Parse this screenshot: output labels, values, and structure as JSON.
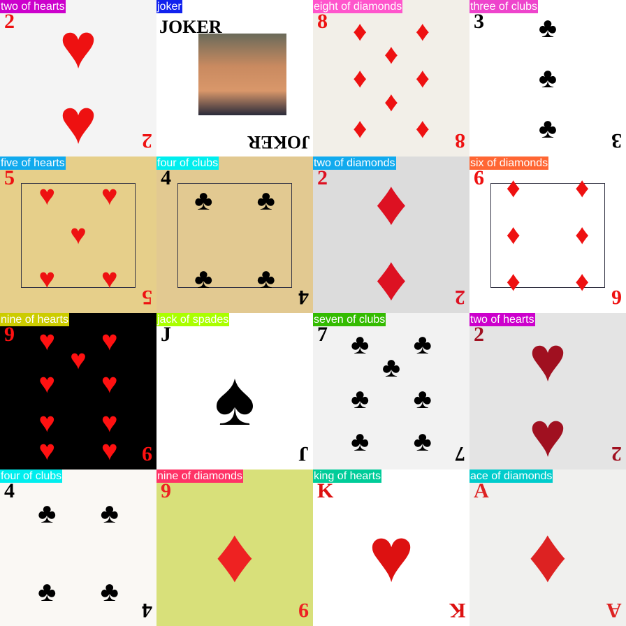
{
  "tiles": [
    {
      "label": "two of hearts",
      "label_color": "#cc00cc",
      "bg": "#f4f4f4",
      "rank": "2",
      "suit": "♥",
      "suit_color": "#ee1111",
      "pips": 2
    },
    {
      "label": "joker",
      "label_color": "#1122ee",
      "bg": "#ffffff",
      "rank": "",
      "suit": "",
      "suit_color": "#111111",
      "pips": 0,
      "joker_text": "JOKER"
    },
    {
      "label": "eight of diamonds",
      "label_color": "#ff55cc",
      "bg": "#f2efe8",
      "rank": "8",
      "suit": "♦",
      "suit_color": "#ee1111",
      "pips": 8
    },
    {
      "label": "three of clubs",
      "label_color": "#ee44cc",
      "bg": "#ffffff",
      "rank": "3",
      "suit": "♣",
      "suit_color": "#000000",
      "pips": 3
    },
    {
      "label": "five of hearts",
      "label_color": "#11aaee",
      "bg": "#e6cf8a",
      "rank": "5",
      "suit": "♥",
      "suit_color": "#ee1111",
      "pips": 5,
      "framed": true
    },
    {
      "label": "four of clubs",
      "label_color": "#00eeee",
      "bg": "#e2c991",
      "rank": "4",
      "suit": "♣",
      "suit_color": "#000000",
      "pips": 4,
      "framed": true
    },
    {
      "label": "two of diamonds",
      "label_color": "#11aaee",
      "bg": "#dcdcdc",
      "rank": "2",
      "suit": "♦",
      "suit_color": "#dd1122",
      "pips": 2
    },
    {
      "label": "six of diamonds",
      "label_color": "#ff6633",
      "bg": "#ffffff",
      "rank": "6",
      "suit": "♦",
      "suit_color": "#ee1111",
      "pips": 6,
      "framed": true
    },
    {
      "label": "nine of hearts",
      "label_color": "#cccc00",
      "bg": "#000000",
      "rank": "9",
      "suit": "♥",
      "suit_color": "#ff1111",
      "pips": 9
    },
    {
      "label": "jack of spades",
      "label_color": "#aaff00",
      "bg": "#ffffff",
      "rank": "J",
      "suit": "♠",
      "suit_color": "#000000",
      "pips": 1
    },
    {
      "label": "seven of clubs",
      "label_color": "#33bb00",
      "bg": "#f2f2f2",
      "rank": "7",
      "suit": "♣",
      "suit_color": "#000000",
      "pips": 7
    },
    {
      "label": "two of hearts",
      "label_color": "#cc00cc",
      "bg": "#e4e4e4",
      "rank": "2",
      "suit": "♥",
      "suit_color": "#a01020",
      "pips": 2
    },
    {
      "label": "four of clubs",
      "label_color": "#00eeee",
      "bg": "#faf8f4",
      "rank": "4",
      "suit": "♣",
      "suit_color": "#000000",
      "pips": 4
    },
    {
      "label": "nine of diamonds",
      "label_color": "#ff3366",
      "bg": "#d8e07a",
      "rank": "9",
      "suit": "♦",
      "suit_color": "#ee2222",
      "pips": 1
    },
    {
      "label": "king of hearts",
      "label_color": "#00cc99",
      "bg": "#ffffff",
      "rank": "K",
      "suit": "♥",
      "suit_color": "#dd1111",
      "pips": 1
    },
    {
      "label": "ace of diamonds",
      "label_color": "#00cccc",
      "bg": "#f0f0ee",
      "rank": "A",
      "suit": "♦",
      "suit_color": "#dd2222",
      "pips": 1
    }
  ]
}
